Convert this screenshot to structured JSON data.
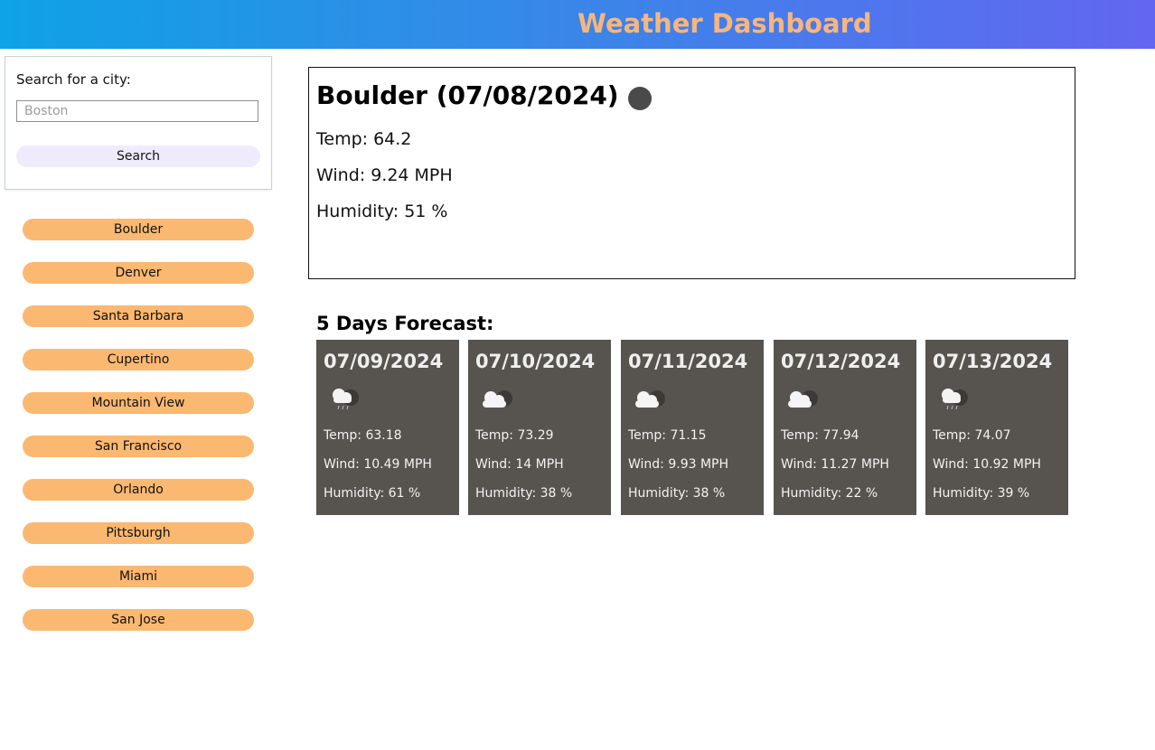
{
  "header": {
    "title": "Weather Dashboard"
  },
  "search": {
    "label": "Search for a city:",
    "placeholder": "Boston",
    "value": "",
    "button_label": "Search"
  },
  "history": [
    "Boulder",
    "Denver",
    "Santa Barbara",
    "Cupertino",
    "Mountain View",
    "San Francisco",
    "Orlando",
    "Pittsburgh",
    "Miami",
    "San Jose"
  ],
  "current": {
    "title": "Boulder (07/08/2024)",
    "temp": "Temp: 64.2",
    "wind": "Wind: 9.24 MPH",
    "humidity": "Humidity: 51 %",
    "icon": "weather-icon-placeholder"
  },
  "forecast": {
    "heading": "5 Days Forecast:",
    "days": [
      {
        "date": "07/09/2024",
        "icon": "cloud-rain-icon",
        "temp": "Temp: 63.18",
        "wind": "Wind: 10.49 MPH",
        "humidity": "Humidity: 61 %"
      },
      {
        "date": "07/10/2024",
        "icon": "cloud-icon",
        "temp": "Temp: 73.29",
        "wind": "Wind: 14 MPH",
        "humidity": "Humidity: 38 %"
      },
      {
        "date": "07/11/2024",
        "icon": "cloud-icon",
        "temp": "Temp: 71.15",
        "wind": "Wind: 9.93 MPH",
        "humidity": "Humidity: 38 %"
      },
      {
        "date": "07/12/2024",
        "icon": "cloud-icon",
        "temp": "Temp: 77.94",
        "wind": "Wind: 11.27 MPH",
        "humidity": "Humidity: 22 %"
      },
      {
        "date": "07/13/2024",
        "icon": "cloud-rain-icon",
        "temp": "Temp: 74.07",
        "wind": "Wind: 10.92 MPH",
        "humidity": "Humidity: 39 %"
      }
    ]
  },
  "colors": {
    "header_gradient_start": "#0ea2e6",
    "header_gradient_end": "#6366f1",
    "header_title": "#f8b67d",
    "history_button": "#fbb870",
    "search_button": "#efebfd",
    "forecast_card": "#57534e"
  }
}
